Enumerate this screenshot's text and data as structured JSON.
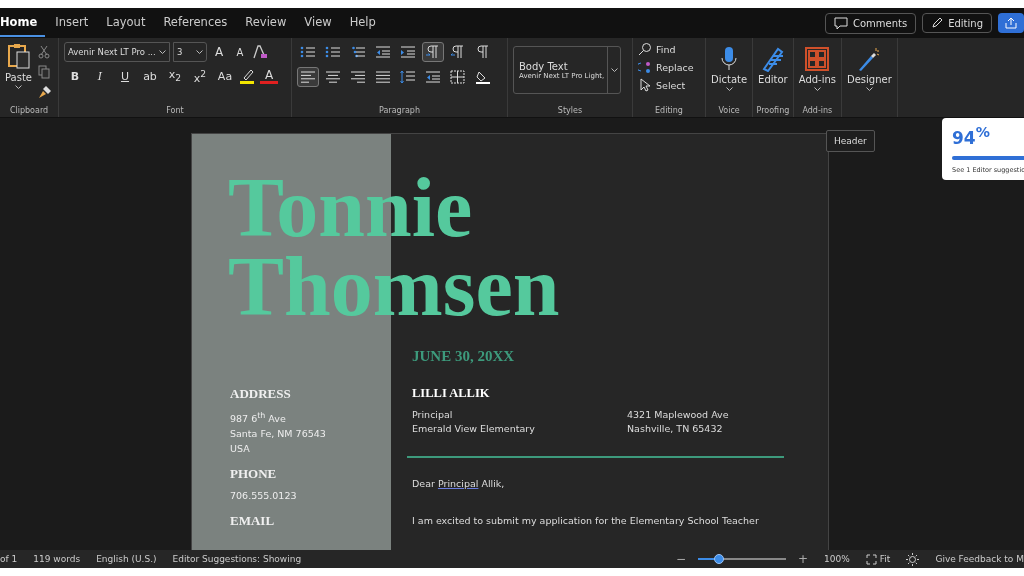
{
  "tabs": [
    {
      "label": "Home",
      "selected": true
    },
    {
      "label": "Insert",
      "selected": false
    },
    {
      "label": "Layout",
      "selected": false
    },
    {
      "label": "References",
      "selected": false
    },
    {
      "label": "Review",
      "selected": false
    },
    {
      "label": "View",
      "selected": false
    },
    {
      "label": "Help",
      "selected": false
    }
  ],
  "top_buttons": {
    "comments": "Comments",
    "editing": "Editing"
  },
  "clipboard": {
    "paste": "Paste",
    "label": "Clipboard"
  },
  "font": {
    "name": "Avenir Next LT Pro ...",
    "size": "3",
    "size_buttons": [
      "A",
      "A"
    ],
    "format_buttons": [
      "B",
      "I",
      "U",
      "ab",
      "x$_{2}$",
      "x$^{2}$",
      "Aa"
    ],
    "color_button": "A",
    "label": "Font"
  },
  "paragraph": {
    "label": "Paragraph",
    "row1": [
      {
        "kind": "bullets",
        "selected": false
      },
      {
        "kind": "numbering",
        "selected": false
      },
      {
        "kind": "multilevel",
        "selected": false
      },
      {
        "kind": "outdent",
        "selected": false
      },
      {
        "kind": "indent",
        "selected": false
      },
      {
        "kind": "ltr",
        "selected": true
      },
      {
        "kind": "rtl",
        "selected": false
      },
      {
        "kind": "pilcrow",
        "selected": false
      }
    ],
    "row2": [
      {
        "kind": "left",
        "selected": true
      },
      {
        "kind": "center",
        "selected": false
      },
      {
        "kind": "right",
        "selected": false
      },
      {
        "kind": "justify",
        "selected": false
      },
      {
        "kind": "spacing",
        "selected": false
      },
      {
        "kind": "outdent",
        "selected": false
      },
      {
        "kind": "borders",
        "selected": false
      },
      {
        "kind": "shading",
        "selected": false
      }
    ]
  },
  "styles": {
    "name": "Body Text",
    "font": "Avenir Next LT Pro Light,",
    "label": "Styles"
  },
  "editing": {
    "find": "Find",
    "replace": "Replace",
    "select": "Select",
    "label": "Editing"
  },
  "big_groups": [
    {
      "kind": "mic",
      "button": "Dictate",
      "label": "Voice"
    },
    {
      "kind": "pen",
      "button": "Editor",
      "label": "Proofing"
    },
    {
      "kind": "grid",
      "button": "Add-ins",
      "label": "Add-ins"
    },
    {
      "kind": "brush",
      "button": "Designer"
    }
  ],
  "document": {
    "header_tooltip": "Header",
    "name_lines": [
      "Tonnie",
      "Thomsen"
    ],
    "date": "JUNE 30, 20XX",
    "sidebar": [
      {
        "heading": "ADDRESS",
        "lines": [
          "987 6$^{th}$ Ave",
          "Santa Fe, NM 76543",
          "USA"
        ]
      },
      {
        "heading": "PHONE",
        "lines": [
          "706.555.0123"
        ]
      },
      {
        "heading": "EMAIL"
      }
    ],
    "recipient": {
      "name": "LILLI ALLIK",
      "left": [
        "Principal",
        "Emerald View Elementary"
      ],
      "right": [
        "4321 Maplewood Ave",
        "Nashville, TN 65432"
      ]
    },
    "salutation": {
      "before": "Dear",
      "flagged": "Principal",
      "after": "Allik,"
    },
    "body": "I am excited to submit my application for the Elementary School Teacher"
  },
  "editor_card": {
    "score": "94$^{%}$",
    "level": 0.94,
    "text": "See 1 Editor suggestio"
  },
  "status_bar": {
    "left": [
      "of 1",
      "119 words",
      "English (U.S.)",
      "Editor Suggestions: Showing"
    ],
    "minus": "−",
    "zoom": {
      "level": 0.24
    },
    "plus": "+",
    "percent": "100%",
    "fit": "Fit",
    "feedback": "Give Feedback to M"
  }
}
